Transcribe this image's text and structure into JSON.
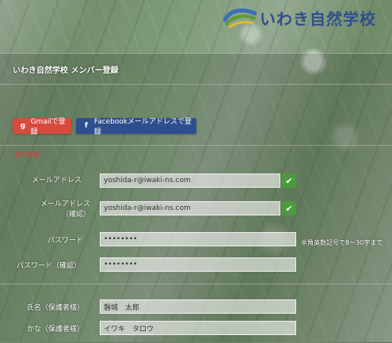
{
  "brand": {
    "logo_text": "いわき自然学校"
  },
  "page": {
    "title": "いわき自然学校 メンバー登録"
  },
  "social": {
    "gmail_label": "Gmailで登録",
    "facebook_label": "Facebookメールアドレスで登録"
  },
  "form": {
    "section_label": "基本情報",
    "email_label": "メールアドレス",
    "email_value": "yoshida-r@iwaki-ns.com",
    "email_confirm_label": "メールアドレス\n（確認）",
    "email_confirm_value": "yoshida-r@iwaki-ns.com",
    "password_label": "パスワード",
    "password_value": "••••••••",
    "password_hint": "半角英数記号で8～30字まで",
    "password_confirm_label": "パスワード（確認）",
    "password_confirm_value": "••••••••",
    "name_label": "氏名（保護者様）",
    "name_value": "磐城　太郎",
    "kana_label": "かな（保護者様）",
    "kana_value": "イワキ　タロウ"
  },
  "colors": {
    "brand_blue": "#2d4f8f",
    "gmail_red": "#d74b3d",
    "success_green": "#4c9a3d",
    "section_red": "#d63f3f"
  },
  "icons": {
    "gmail": "gmail-icon",
    "facebook": "facebook-icon",
    "check": "check-icon"
  }
}
